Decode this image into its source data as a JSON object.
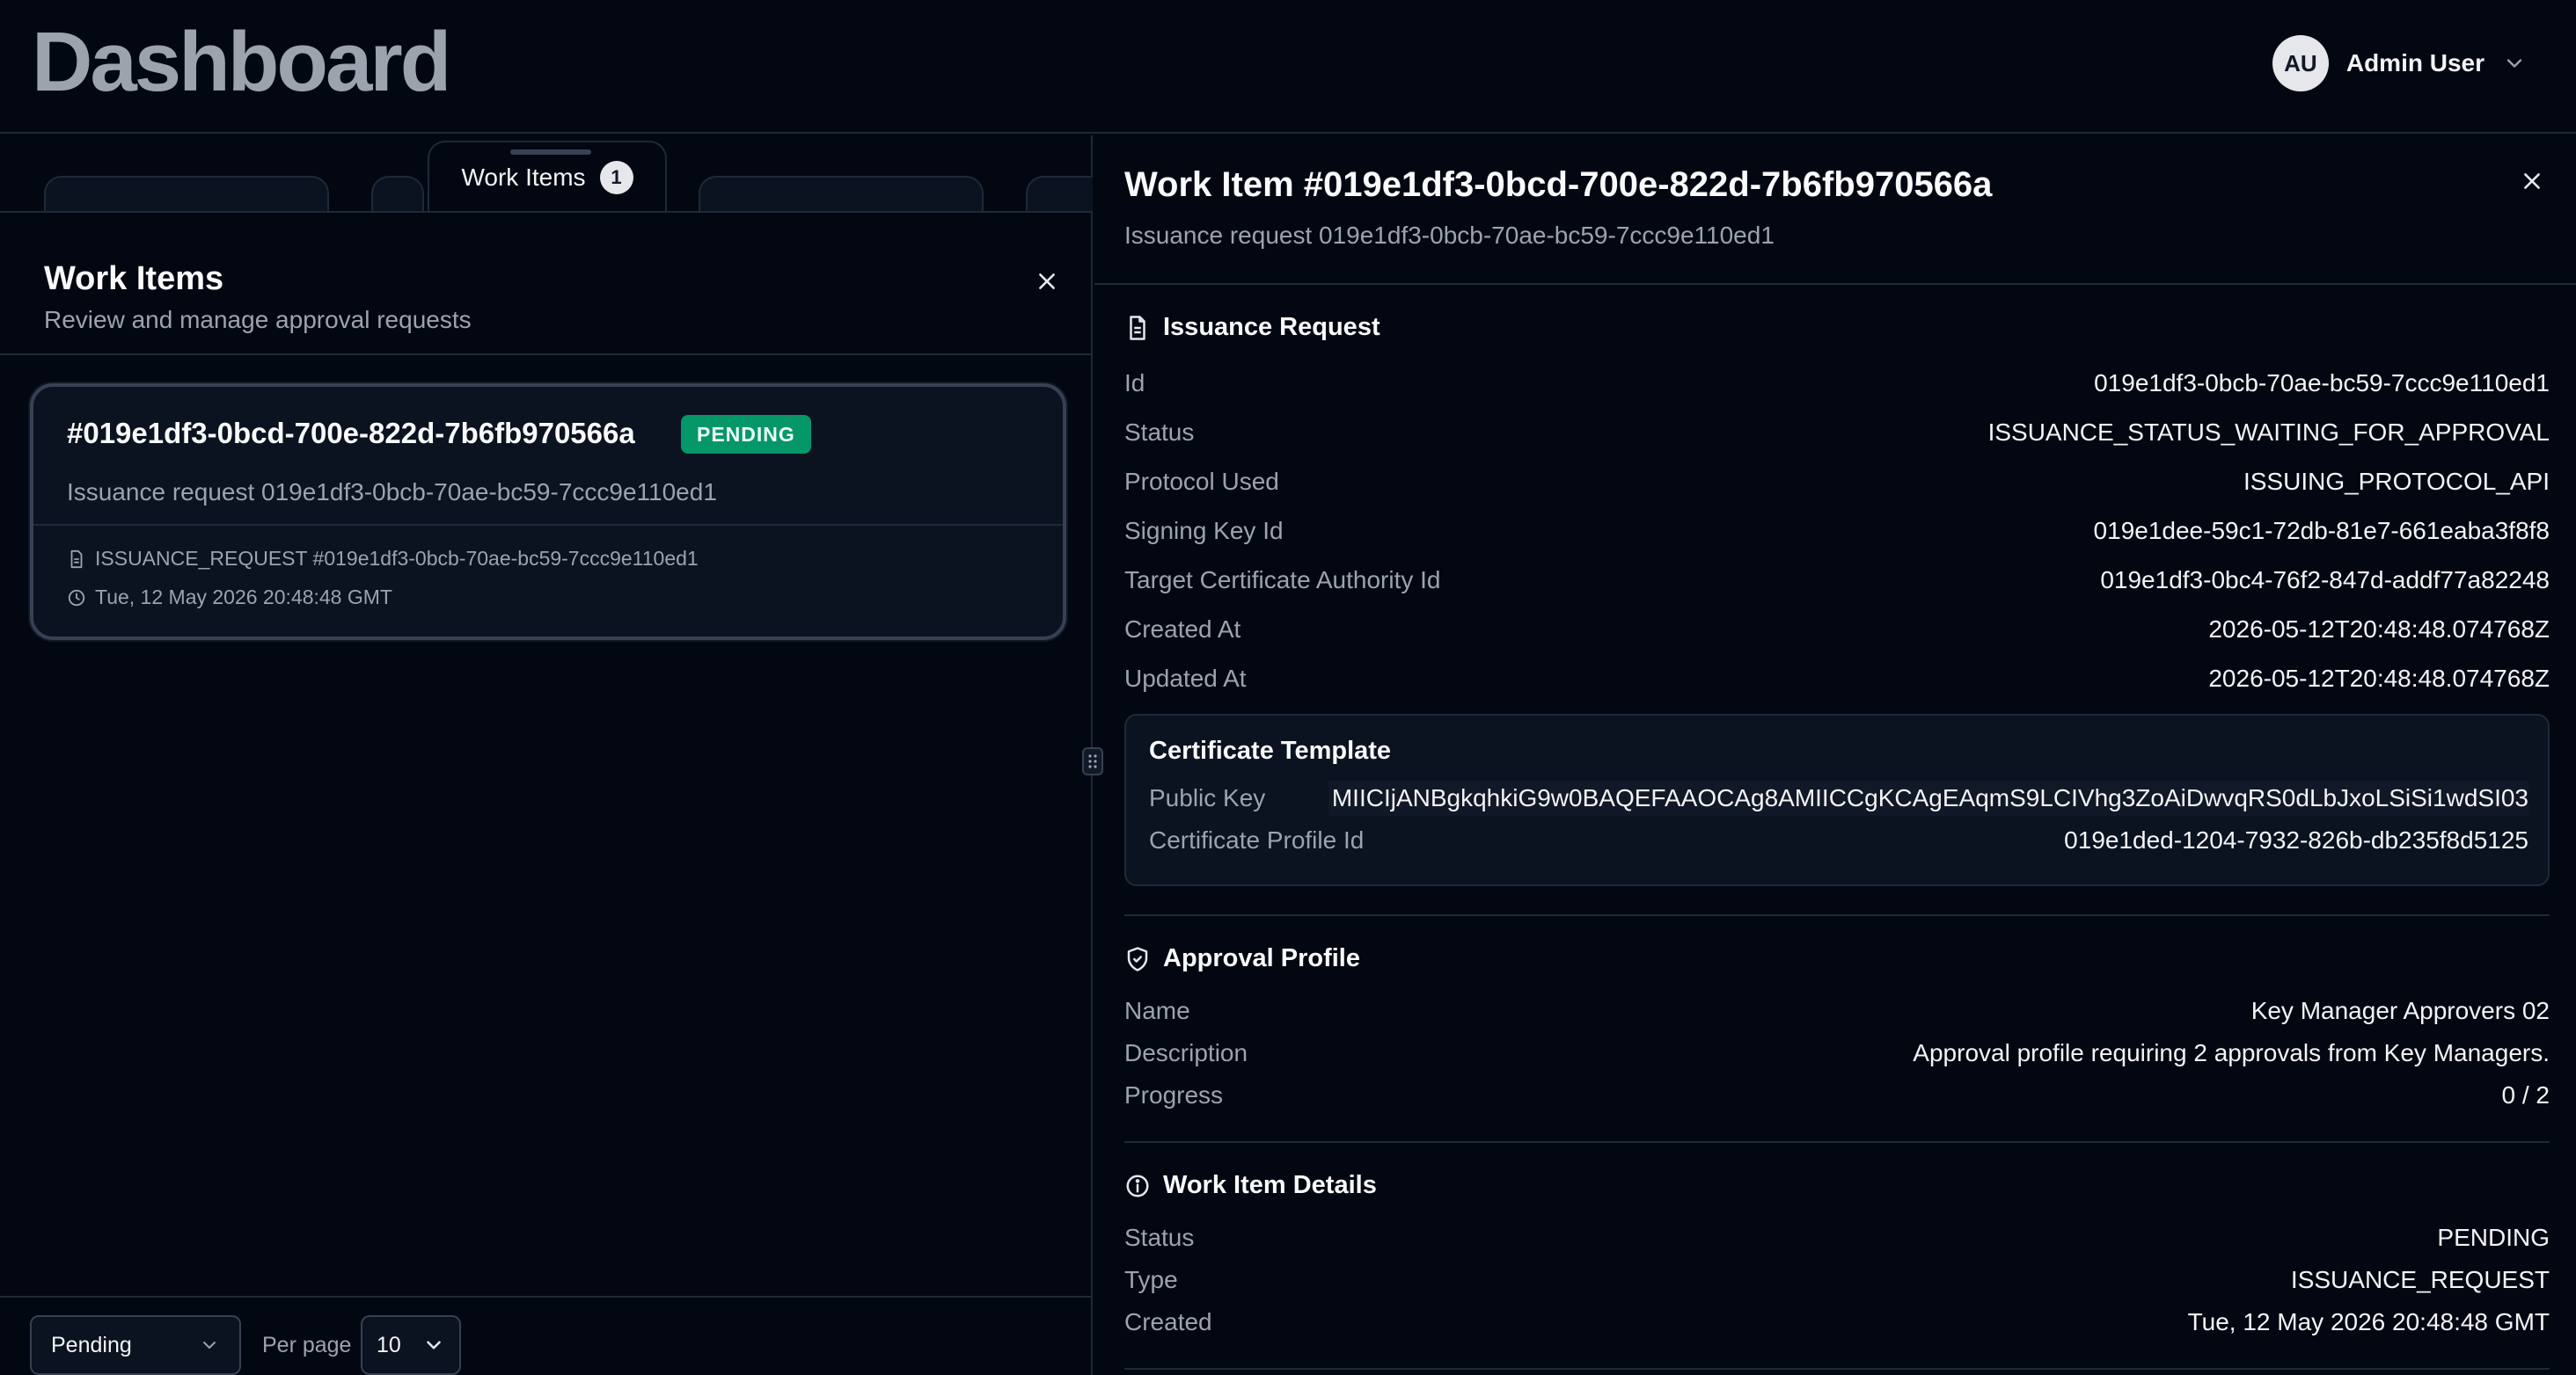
{
  "header": {
    "title": "Dashboard",
    "user": {
      "initials": "AU",
      "name": "Admin User"
    }
  },
  "left_panel": {
    "tab": {
      "label": "Work Items",
      "count": "1"
    },
    "title": "Work Items",
    "subtitle": "Review and manage approval requests",
    "card": {
      "title": "#019e1df3-0bcd-700e-822d-7b6fb970566a",
      "badge": "PENDING",
      "description": "Issuance request 019e1df3-0bcb-70ae-bc59-7ccc9e110ed1",
      "reference": "ISSUANCE_REQUEST #019e1df3-0bcb-70ae-bc59-7ccc9e110ed1",
      "timestamp": "Tue, 12 May 2026 20:48:48 GMT"
    },
    "filter": {
      "selected": "Pending"
    },
    "pagination": {
      "per_page_label": "Per page",
      "per_page_value": "10"
    }
  },
  "detail": {
    "title": "Work Item #019e1df3-0bcd-700e-822d-7b6fb970566a",
    "subtitle": "Issuance request 019e1df3-0bcb-70ae-bc59-7ccc9e110ed1",
    "issuance_request": {
      "heading": "Issuance Request",
      "rows": [
        {
          "label": "Id",
          "value": "019e1df3-0bcb-70ae-bc59-7ccc9e110ed1"
        },
        {
          "label": "Status",
          "value": "ISSUANCE_STATUS_WAITING_FOR_APPROVAL"
        },
        {
          "label": "Protocol Used",
          "value": "ISSUING_PROTOCOL_API"
        },
        {
          "label": "Signing Key Id",
          "value": "019e1dee-59c1-72db-81e7-661eaba3f8f8"
        },
        {
          "label": "Target Certificate Authority Id",
          "value": "019e1df3-0bc4-76f2-847d-addf77a82248"
        },
        {
          "label": "Created At",
          "value": "2026-05-12T20:48:48.074768Z"
        },
        {
          "label": "Updated At",
          "value": "2026-05-12T20:48:48.074768Z"
        }
      ],
      "template": {
        "heading": "Certificate Template",
        "rows": [
          {
            "label": "Public Key",
            "value": "MIICIjANBgkqhkiG9w0BAQEFAAOCAg8AMIICCgKCAgEAqmS9LCIVhg3ZoAiDwvqRS0dLbJxoLSiSi1wdSI03"
          },
          {
            "label": "Certificate Profile Id",
            "value": "019e1ded-1204-7932-826b-db235f8d5125"
          }
        ]
      }
    },
    "approval_profile": {
      "heading": "Approval Profile",
      "rows": [
        {
          "label": "Name",
          "value": "Key Manager Approvers 02"
        },
        {
          "label": "Description",
          "value": "Approval profile requiring 2 approvals from Key Managers."
        },
        {
          "label": "Progress",
          "value": "0 / 2"
        }
      ]
    },
    "work_item_details": {
      "heading": "Work Item Details",
      "rows": [
        {
          "label": "Status",
          "value": "PENDING"
        },
        {
          "label": "Type",
          "value": "ISSUANCE_REQUEST"
        },
        {
          "label": "Created",
          "value": "Tue, 12 May 2026 20:48:48 GMT"
        }
      ]
    }
  },
  "colors": {
    "background": "#030712",
    "border": "#1f2937",
    "badge_green": "#059669",
    "muted_text": "#9ca3af"
  }
}
